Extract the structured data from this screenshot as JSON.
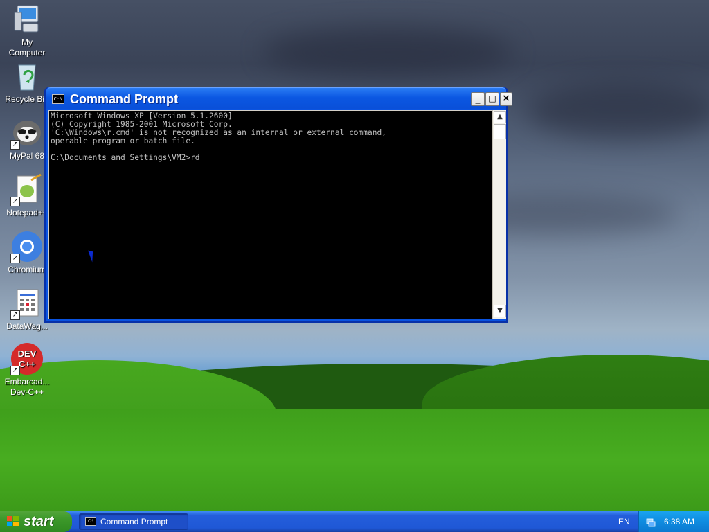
{
  "desktop": {
    "icons": [
      {
        "label": "My\nComputer",
        "icon": "my-computer-icon"
      },
      {
        "label": "Recycle Bin",
        "icon": "recycle-bin-icon"
      },
      {
        "label": "MyPal 68",
        "icon": "mypal-icon"
      },
      {
        "label": "Notepad++",
        "icon": "notepad-plus-plus-icon"
      },
      {
        "label": "Chromium",
        "icon": "chromium-icon"
      },
      {
        "label": "DataWag...",
        "icon": "datawag-icon"
      },
      {
        "label": "Embarcad...\nDev-C++",
        "icon": "dev-cpp-icon"
      }
    ]
  },
  "window": {
    "title": "Command Prompt",
    "minimize": "_",
    "maximize": "□",
    "close": "×",
    "console_text": "Microsoft Windows XP [Version 5.1.2600]\n(C) Copyright 1985-2001 Microsoft Corp.\n'C:\\Windows\\r.cmd' is not recognized as an internal or external command,\noperable program or batch file.\n\nC:\\Documents and Settings\\VM2>rd"
  },
  "taskbar": {
    "start_label": "start",
    "task_item": "Command Prompt",
    "language": "EN",
    "time": "6:38 AM"
  },
  "colors": {
    "titlebar": "#0a4fd8",
    "console_bg": "#000000",
    "console_fg": "#c0c0c0",
    "start": "#3c982a",
    "taskbar": "#245edb"
  }
}
